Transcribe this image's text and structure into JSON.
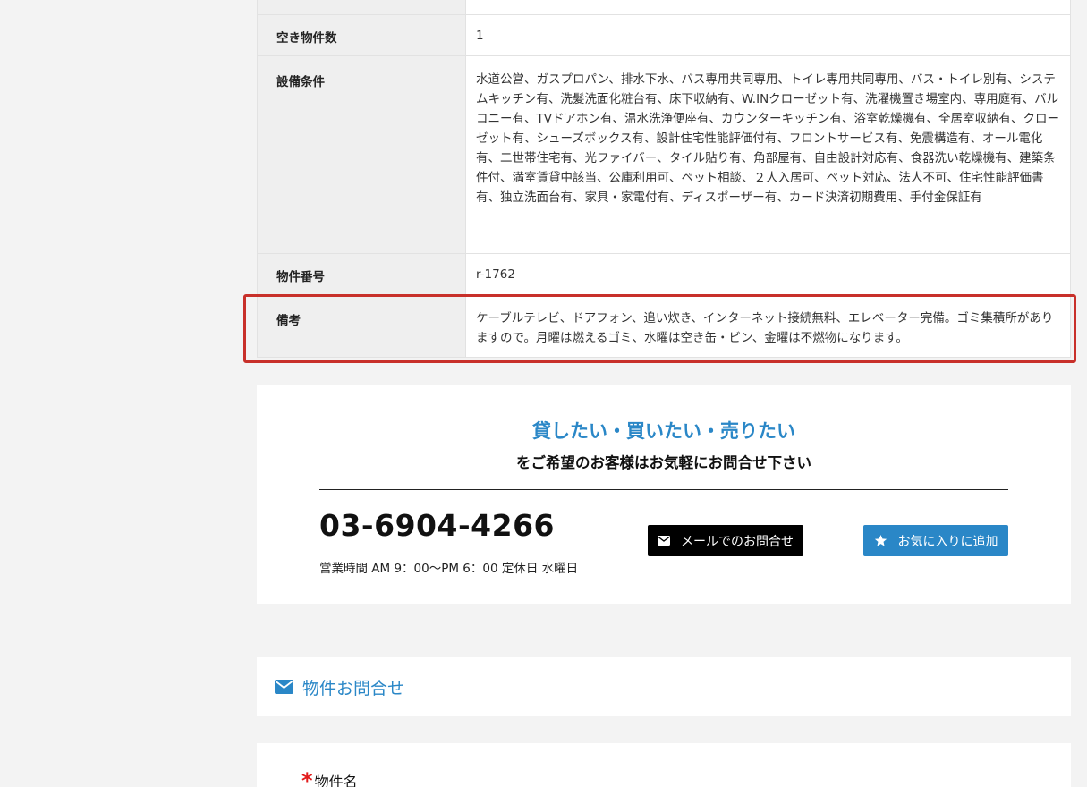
{
  "spec": {
    "rows": [
      {
        "label": "",
        "value": ""
      },
      {
        "label": "空き物件数",
        "value": "1"
      },
      {
        "label": "設備条件",
        "value": "水道公営、ガスプロパン、排水下水、バス専用共同専用、トイレ専用共同専用、バス・トイレ別有、システムキッチン有、洗髪洗面化粧台有、床下収納有、W.INクローゼット有、洗濯機置き場室内、専用庭有、バルコニー有、TVドアホン有、温水洗浄便座有、カウンターキッチン有、浴室乾燥機有、全居室収納有、クローゼット有、シューズボックス有、設計住宅性能評価付有、フロントサービス有、免震構造有、オール電化有、二世帯住宅有、光ファイバー、タイル貼り有、角部屋有、自由設計対応有、食器洗い乾燥機有、建築条件付、満室賃貸中該当、公庫利用可、ペット相談、２人入居可、ペット対応、法人不可、住宅性能評価書有、独立洗面台有、家具・家電付有、ディスポーザー有、カード決済初期費用、手付金保証有"
      },
      {
        "label": "物件番号",
        "value": "r-1762"
      },
      {
        "label": "備考",
        "value": "ケーブルテレビ、ドアフォン、追い炊き、インターネット接続無料、エレベーター完備。ゴミ集積所がありますので。月曜は燃えるゴミ、水曜は空き缶・ビン、金曜は不燃物になります。"
      }
    ]
  },
  "contact": {
    "title": "貸したい・買いたい・売りたい",
    "subtitle": "をご希望のお客様はお気軽にお問合せ下さい",
    "phone": "03-6904-4266",
    "hours": "営業時間 AM 9：00〜PM 6：00 定休日 水曜日",
    "mail_button": "メールでのお問合せ",
    "fav_button": "お気に入りに追加"
  },
  "inquiry": {
    "title": "物件お問合せ"
  },
  "form": {
    "required_mark": "*",
    "property_name_label": "物件名"
  },
  "icons": {
    "mail": "envelope-icon",
    "favorite": "star-icon"
  },
  "colors": {
    "accent": "#2a87c7",
    "highlight": "#c8302a",
    "required": "#e21b1b"
  }
}
